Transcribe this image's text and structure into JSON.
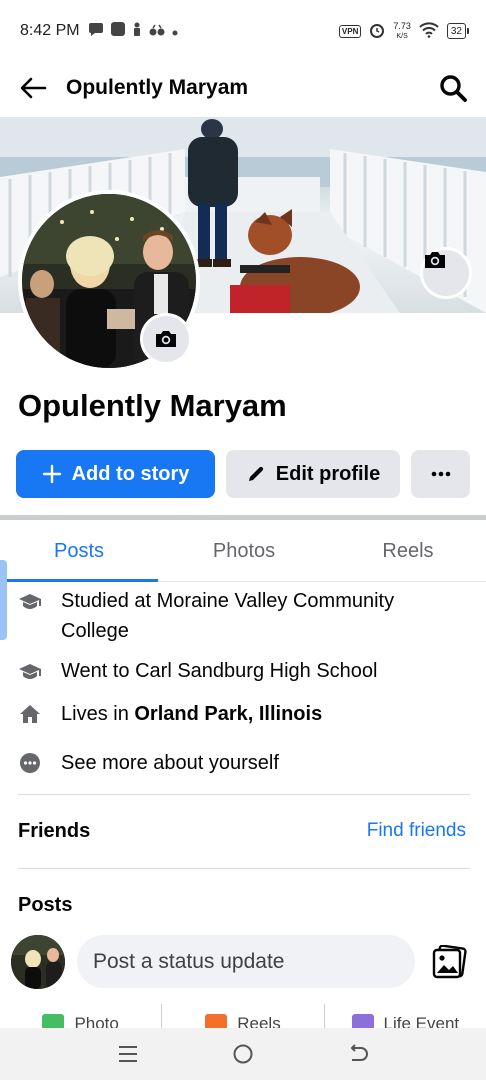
{
  "status_bar": {
    "time": "8:42 PM",
    "vpn": "VPN",
    "speed_value": "7.73",
    "speed_unit": "K/S",
    "battery": "32"
  },
  "header": {
    "title": "Opulently Maryam"
  },
  "profile": {
    "name": "Opulently Maryam"
  },
  "buttons": {
    "add_to_story": "Add to story",
    "edit_profile": "Edit profile",
    "more": "···"
  },
  "tabs": [
    {
      "label": "Posts",
      "active": true
    },
    {
      "label": "Photos",
      "active": false
    },
    {
      "label": "Reels",
      "active": false
    }
  ],
  "details": {
    "studied": "Studied at Moraine Valley Community College",
    "went_prefix": "Went to Carl Sandburg High School",
    "lives_prefix": "Lives in ",
    "lives_place": "Orland Park, Illinois",
    "see_more": "See more about yourself"
  },
  "friends": {
    "title": "Friends",
    "find_friends": "Find friends"
  },
  "posts": {
    "title": "Posts",
    "composer_placeholder": "Post a status update"
  },
  "actions": [
    {
      "label": "Photo",
      "icon": "photo-icon",
      "color": "#45bd62"
    },
    {
      "label": "Reels",
      "icon": "reels-icon",
      "color": "#f3702b"
    },
    {
      "label": "Life Event",
      "icon": "flag-icon",
      "color": "#8c6fd8"
    }
  ],
  "colors": {
    "accent": "#1877f2",
    "button_gray": "#e4e6eb"
  }
}
